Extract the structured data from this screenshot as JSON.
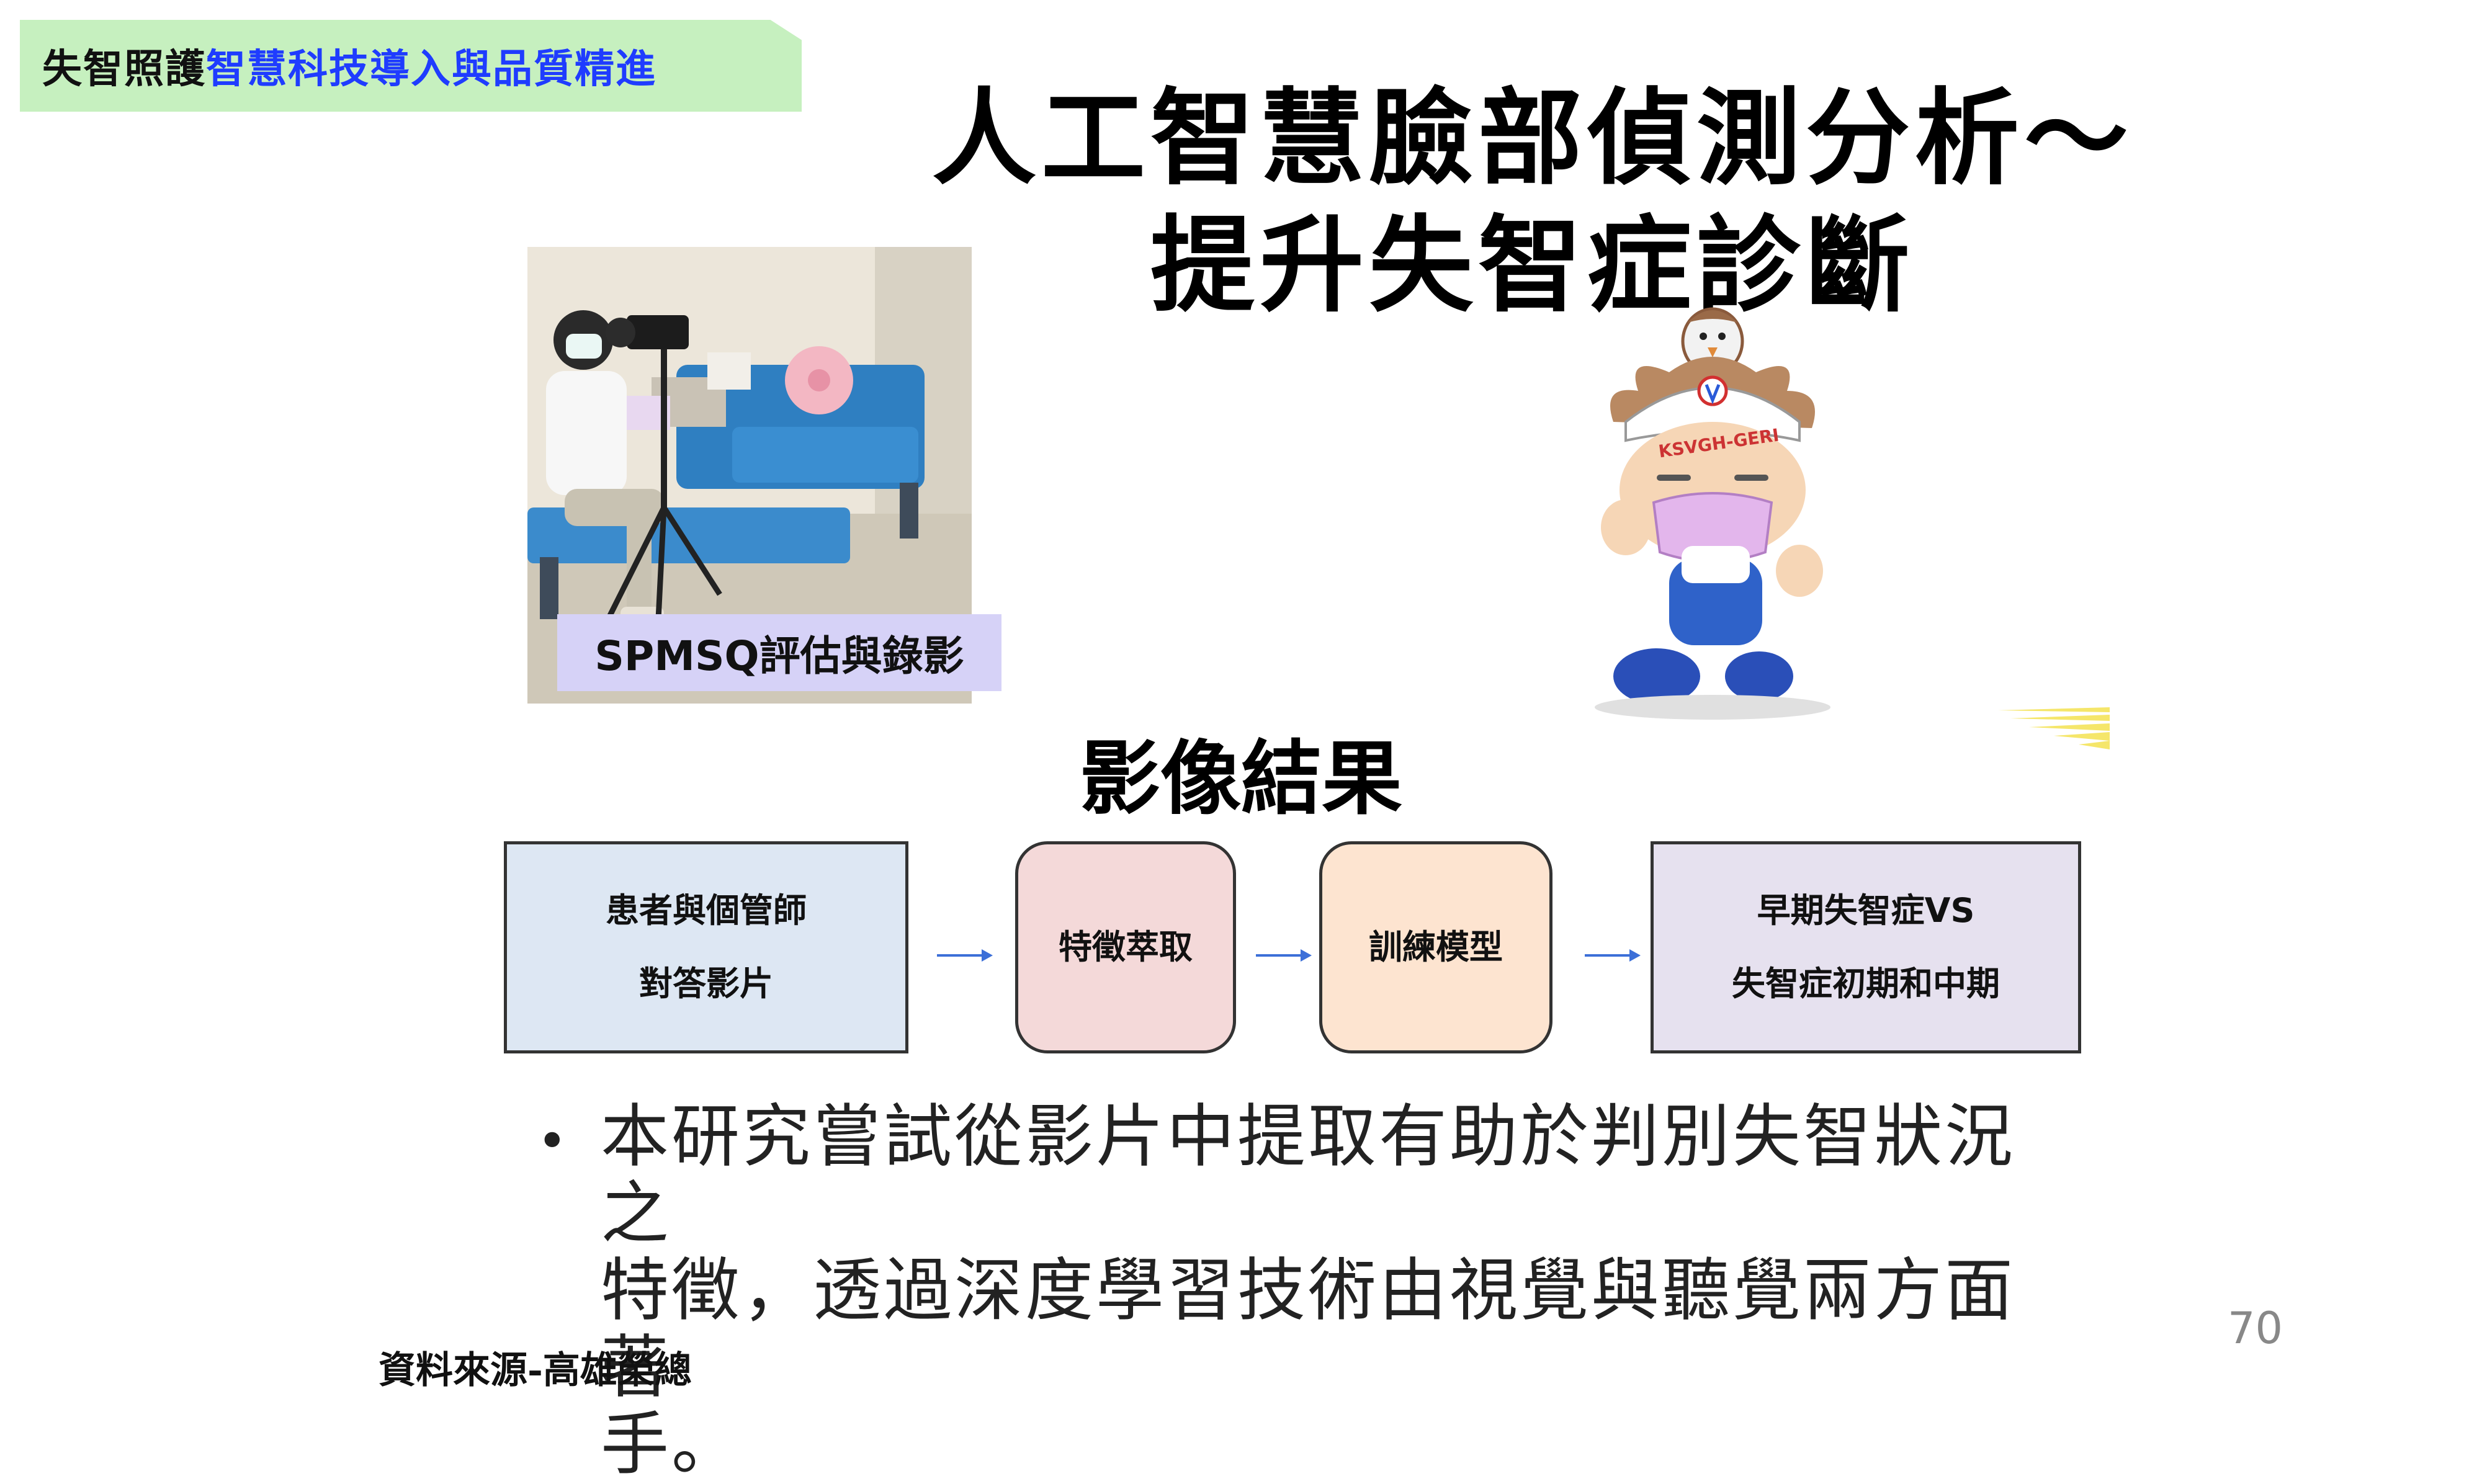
{
  "header": {
    "tag_prefix": "失智照護",
    "tag_highlight": "智慧科技導入與品質精進"
  },
  "title": {
    "line1": "人工智慧臉部偵測分析～",
    "line2": "提升失智症診斷"
  },
  "photo": {
    "caption": "SPMSQ評估與錄影"
  },
  "mascot": {
    "badge_text": "KSVGH-GERI"
  },
  "results": {
    "heading": "影像結果",
    "flow": [
      {
        "line1": "患者與個管師",
        "line2": "對答影片"
      },
      {
        "line1": "特徵萃取"
      },
      {
        "line1": "訓練模型"
      },
      {
        "line1": "早期失智症VS",
        "line2": "失智症初期和中期"
      }
    ]
  },
  "bullet": {
    "line1": "本研究嘗試從影片中提取有助於判別失智狀況之",
    "line2": "特徵，透過深度學習技術由視覺與聽覺兩方面著",
    "line3": "手。"
  },
  "footer": {
    "source": "資料來源-高雄榮總",
    "page_number": "70"
  },
  "colors": {
    "header_bg": "#c6f0bf",
    "header_blue": "#1f3cff",
    "arrow": "#3c6fd8",
    "caption_bg": "#d6d2f7"
  }
}
